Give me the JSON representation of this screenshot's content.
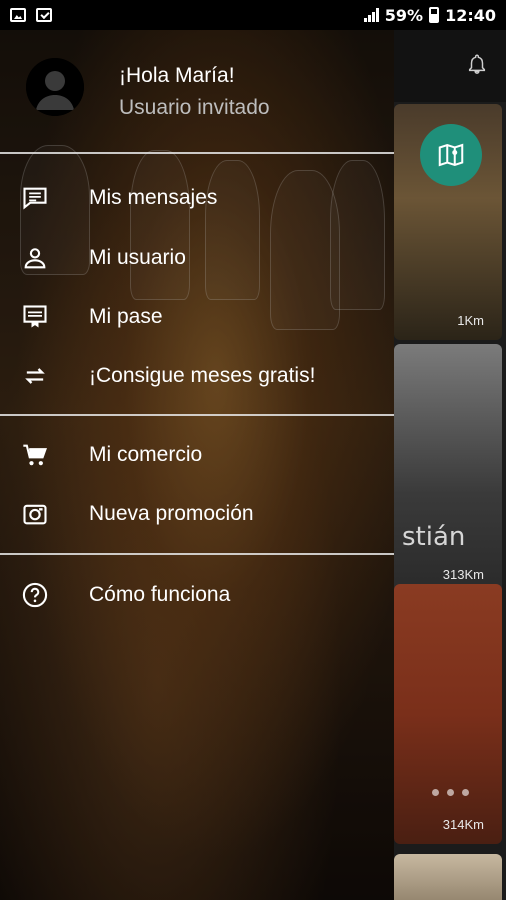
{
  "status_bar": {
    "battery": "59%",
    "time": "12:40",
    "left_icons": [
      "image-icon",
      "checkbox-icon"
    ]
  },
  "drawer": {
    "greeting": "¡Hola María!",
    "subtitle": "Usuario invitado",
    "items": [
      {
        "icon": "message-icon",
        "label": "Mis mensajes"
      },
      {
        "icon": "user-icon",
        "label": "Mi usuario"
      },
      {
        "icon": "pass-icon",
        "label": "Mi pase"
      },
      {
        "icon": "swap-icon",
        "label": "¡Consigue meses gratis!"
      },
      {
        "icon": "cart-icon",
        "label": "Mi comercio"
      },
      {
        "icon": "camera-icon",
        "label": "Nueva promoción"
      },
      {
        "icon": "help-icon",
        "label": "Cómo funciona"
      }
    ]
  },
  "background_list": {
    "cards": [
      {
        "distance": "1Km"
      },
      {
        "title_fragment": "stián",
        "distance": "313Km"
      },
      {
        "distance": "314Km"
      }
    ]
  },
  "colors": {
    "fab": "#1f8f7a",
    "divider": "#e6e6e6"
  }
}
